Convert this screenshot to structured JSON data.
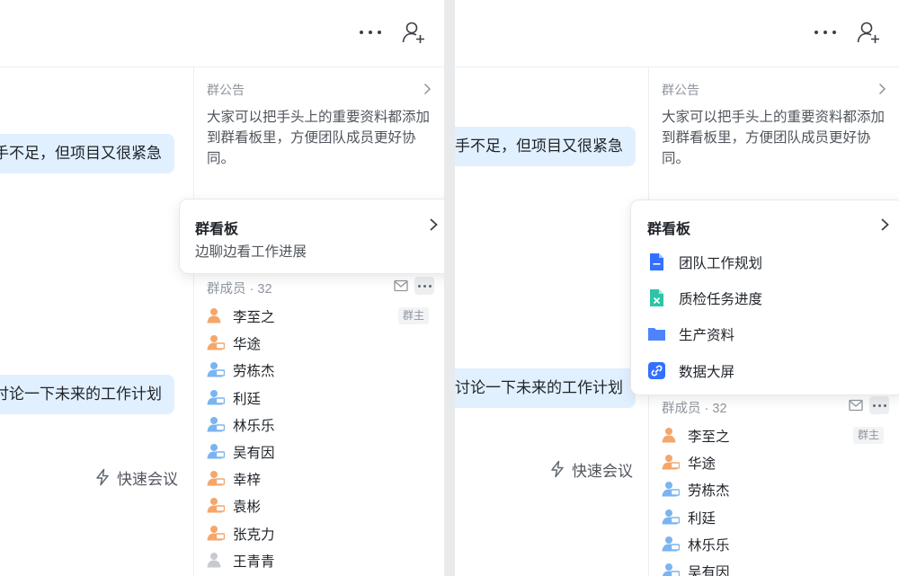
{
  "notice": {
    "title": "群公告",
    "text": "大家可以把手头上的重要资料都添加到群看板里，方便团队成员更好协同。"
  },
  "chat": {
    "bubble1": "手不足，但项目又很紧急",
    "bubble2": "讨论一下未来的工作计划",
    "quick_meeting": "快速会议"
  },
  "kanban": {
    "title": "群看板",
    "subtitle": "边聊边看工作进展",
    "items": [
      {
        "label": "团队工作规划",
        "icon": "doc-icon",
        "color": "#3370ff"
      },
      {
        "label": "质检任务进度",
        "icon": "sheet-icon",
        "color": "#2ec4a5"
      },
      {
        "label": "生产资料",
        "icon": "folder-icon",
        "color": "#4e83fd"
      },
      {
        "label": "数据大屏",
        "icon": "link-icon",
        "color": "#3370ff"
      }
    ]
  },
  "members": {
    "label": "群成员",
    "count": "32",
    "owner_badge": "群主",
    "list": [
      {
        "name": "李至之",
        "type": "owner"
      },
      {
        "name": "华途",
        "type": "orange-device"
      },
      {
        "name": "劳栋杰",
        "type": "blue-device"
      },
      {
        "name": "利廷",
        "type": "blue-device"
      },
      {
        "name": "林乐乐",
        "type": "blue-device"
      },
      {
        "name": "吴有因",
        "type": "blue-device"
      },
      {
        "name": "幸梓",
        "type": "orange-device"
      },
      {
        "name": "袁彬",
        "type": "orange-device"
      },
      {
        "name": "张克力",
        "type": "orange-device"
      },
      {
        "name": "王青青",
        "type": "gray"
      }
    ]
  },
  "colors": {
    "bubble": "#e1f0ff",
    "orange_avatar": "#f5a66b",
    "blue_avatar": "#7bb4f0",
    "gray_avatar": "#c7cad0"
  }
}
